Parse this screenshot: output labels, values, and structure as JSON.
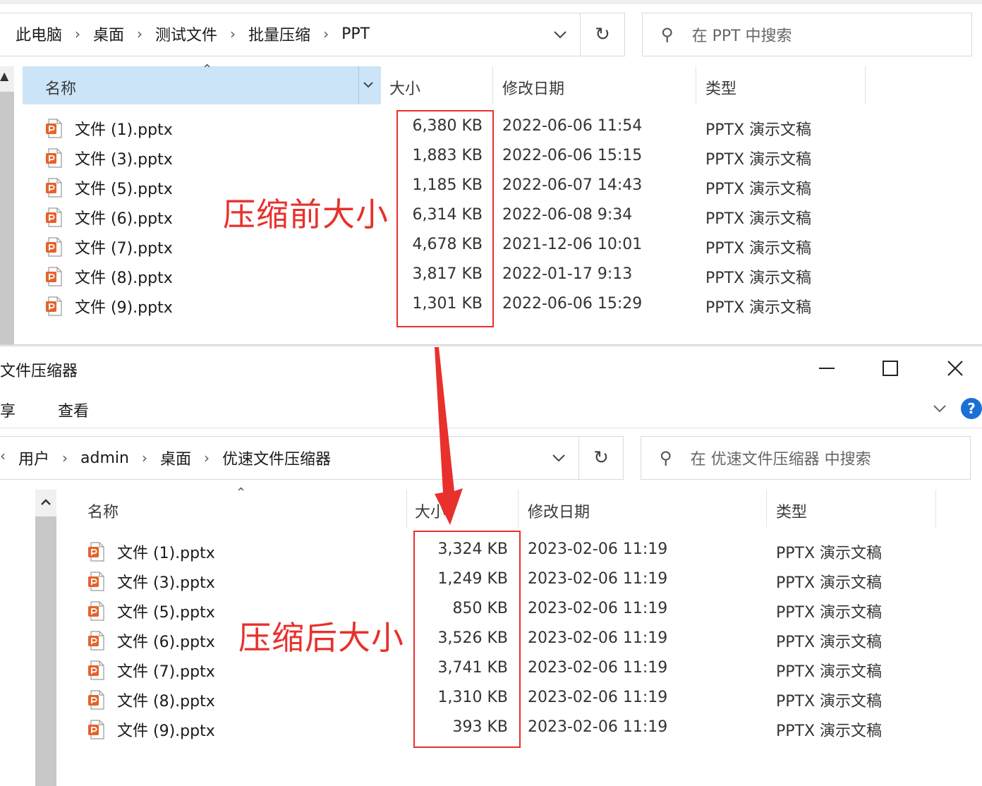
{
  "top": {
    "breadcrumbs": [
      "此电脑",
      "桌面",
      "测试文件",
      "批量压缩",
      "PPT"
    ],
    "search_placeholder": "在 PPT 中搜索",
    "columns": {
      "name": "名称",
      "size": "大小",
      "modified": "修改日期",
      "type": "类型"
    },
    "files": [
      {
        "name": "文件 (1).pptx",
        "size": "6,380 KB",
        "modified": "2022-06-06 11:54",
        "type": "PPTX 演示文稿"
      },
      {
        "name": "文件 (3).pptx",
        "size": "1,883 KB",
        "modified": "2022-06-06 15:15",
        "type": "PPTX 演示文稿"
      },
      {
        "name": "文件 (5).pptx",
        "size": "1,185 KB",
        "modified": "2022-06-07 14:43",
        "type": "PPTX 演示文稿"
      },
      {
        "name": "文件 (6).pptx",
        "size": "6,314 KB",
        "modified": "2022-06-08 9:34",
        "type": "PPTX 演示文稿"
      },
      {
        "name": "文件 (7).pptx",
        "size": "4,678 KB",
        "modified": "2021-12-06 10:01",
        "type": "PPTX 演示文稿"
      },
      {
        "name": "文件 (8).pptx",
        "size": "3,817 KB",
        "modified": "2022-01-17 9:13",
        "type": "PPTX 演示文稿"
      },
      {
        "name": "文件 (9).pptx",
        "size": "1,301 KB",
        "modified": "2022-06-06 15:29",
        "type": "PPTX 演示文稿"
      }
    ],
    "annotation": "压缩前大小"
  },
  "bottom": {
    "window_title": "文件压缩器",
    "menu": [
      "享",
      "查看"
    ],
    "breadcrumbs": [
      "用户",
      "admin",
      "桌面",
      "优速文件压缩器"
    ],
    "search_placeholder": "在 优速文件压缩器 中搜索",
    "columns": {
      "name": "名称",
      "size": "大小",
      "modified": "修改日期",
      "type": "类型"
    },
    "files": [
      {
        "name": "文件 (1).pptx",
        "size": "3,324 KB",
        "modified": "2023-02-06 11:19",
        "type": "PPTX 演示文稿"
      },
      {
        "name": "文件 (3).pptx",
        "size": "1,249 KB",
        "modified": "2023-02-06 11:19",
        "type": "PPTX 演示文稿"
      },
      {
        "name": "文件 (5).pptx",
        "size": "850 KB",
        "modified": "2023-02-06 11:19",
        "type": "PPTX 演示文稿"
      },
      {
        "name": "文件 (6).pptx",
        "size": "3,526 KB",
        "modified": "2023-02-06 11:19",
        "type": "PPTX 演示文稿"
      },
      {
        "name": "文件 (7).pptx",
        "size": "3,741 KB",
        "modified": "2023-02-06 11:19",
        "type": "PPTX 演示文稿"
      },
      {
        "name": "文件 (8).pptx",
        "size": "1,310 KB",
        "modified": "2023-02-06 11:19",
        "type": "PPTX 演示文稿"
      },
      {
        "name": "文件 (9).pptx",
        "size": "393 KB",
        "modified": "2023-02-06 11:19",
        "type": "PPTX 演示文稿"
      }
    ],
    "annotation": "压缩后大小"
  },
  "icons": {
    "file": "pptx-file-icon",
    "refresh": "refresh-icon",
    "search": "search-icon",
    "chevron": "chevron-down-icon",
    "minimize": "minimize-icon",
    "maximize": "maximize-icon",
    "close": "close-icon",
    "help": "help-icon"
  },
  "colors": {
    "annotation_red": "#e8302c",
    "sorted_header": "#cce4f7",
    "pptx_orange": "#e5632a",
    "help_blue": "#1b6fd6"
  }
}
